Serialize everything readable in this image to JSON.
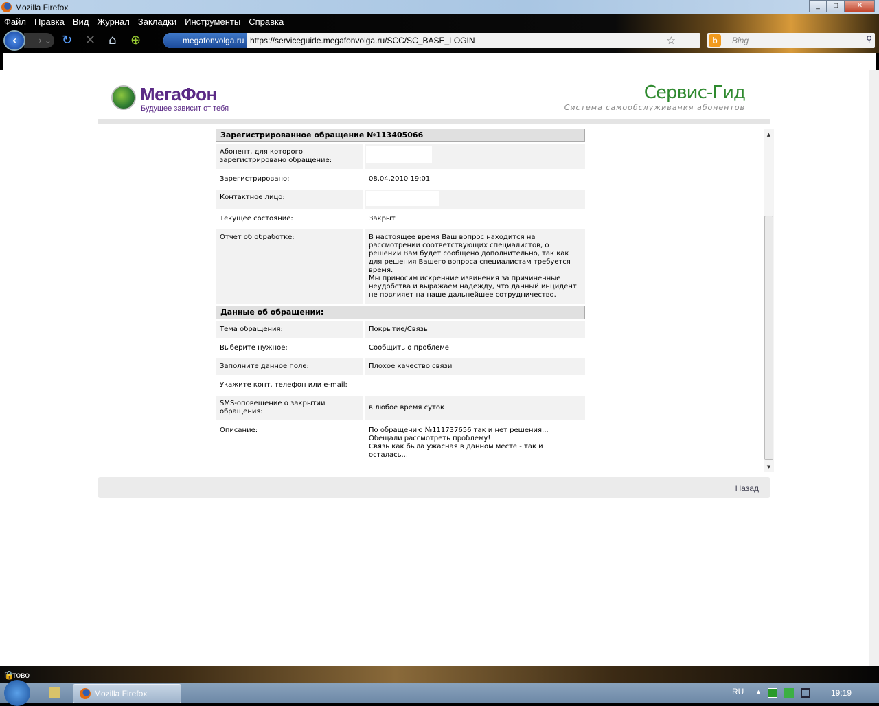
{
  "window": {
    "title": "Mozilla Firefox",
    "min": "_",
    "max": "□",
    "close": "✕"
  },
  "menu": [
    "Файл",
    "Правка",
    "Вид",
    "Журнал",
    "Закладки",
    "Инструменты",
    "Справка"
  ],
  "nav": {
    "site_badge": "megafonvolga.ru",
    "url": "https://serviceguide.megafonvolga.ru/SCC/SC_BASE_LOGIN",
    "search_placeholder": "Bing"
  },
  "header": {
    "logo_name": "МегаФон",
    "logo_slogan": "Будущее зависит от тебя",
    "service_title": "Сервис-Гид",
    "service_subtitle": "Система самообслуживания абонентов"
  },
  "ticket": {
    "title": "Зарегистрированное обращение №113405066",
    "rows": [
      {
        "label": "Абонент, для которого зарегистрировано обращение:",
        "value": ""
      },
      {
        "label": "Зарегистрировано:",
        "value": "08.04.2010 19:01"
      },
      {
        "label": "Контактное лицо:",
        "value": ""
      },
      {
        "label": "Текущее состояние:",
        "value": "Закрыт"
      },
      {
        "label": "Отчет об обработке:",
        "value": "В настоящее время Ваш вопрос находится на рассмотрении соответствующих специалистов, о решении Вам будет сообщено дополнительно, так как для решения Вашего вопроса специалистам требуется время.\nМы приносим искренние извинения за причиненные неудобства и выражаем надежду, что данный инцидент не повлияет на наше дальнейшее сотрудничество."
      }
    ]
  },
  "details": {
    "title": "Данные об обращении:",
    "rows": [
      {
        "label": "Тема обращения:",
        "value": "Покрытие/Связь"
      },
      {
        "label": "Выберите нужное:",
        "value": "Сообщить о проблеме"
      },
      {
        "label": "Заполните данное поле:",
        "value": "Плохое качество связи"
      },
      {
        "label": "Укажите конт. телефон или e-mail:",
        "value": ""
      },
      {
        "label": "SMS-оповещение о закрытии обращения:",
        "value": "в любое время суток"
      },
      {
        "label": "Описание:",
        "value": "По обращению №111737656 так и нет решения...\nОбещали рассмотреть проблему!\nСвязь как была ужасная в данном месте - так и осталась..."
      }
    ]
  },
  "footer": {
    "back": "Назад"
  },
  "status": "Готово",
  "taskbar": {
    "app": "Mozilla Firefox",
    "lang": "RU",
    "time": "19:19"
  }
}
